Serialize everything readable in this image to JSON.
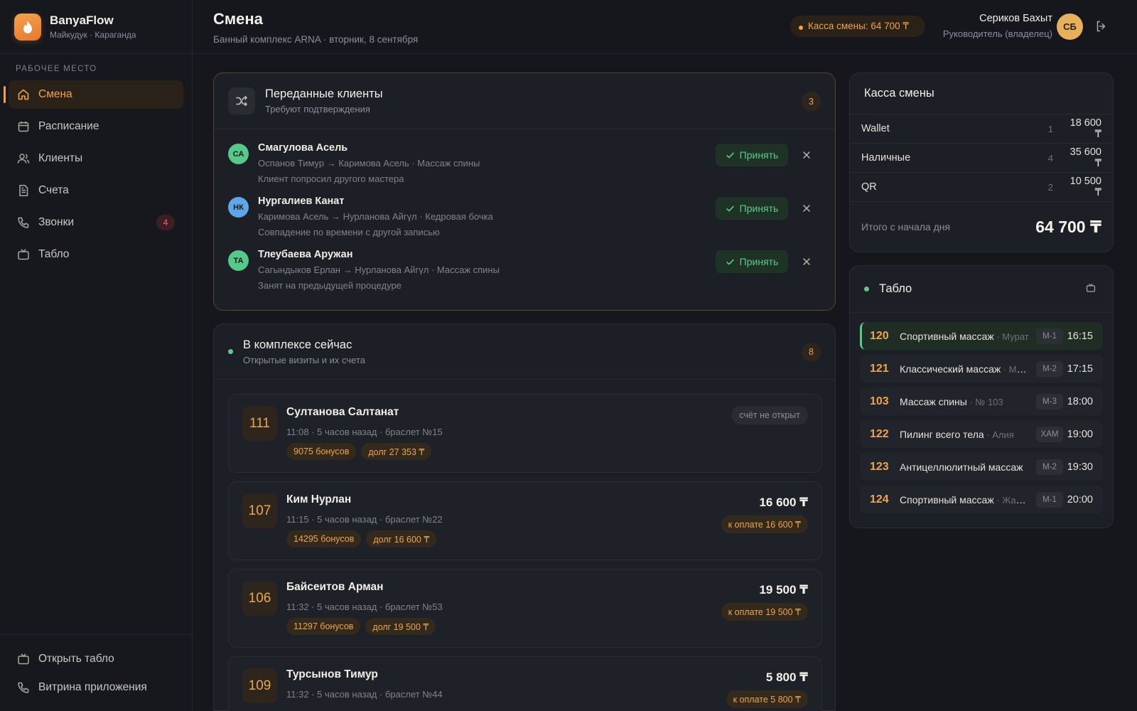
{
  "brand": {
    "name": "BanyaFlow",
    "location": "Майкудук · Караганда"
  },
  "sidebar": {
    "section_label": "РАБОЧЕЕ МЕСТО",
    "items": [
      {
        "label": "Смена",
        "icon": "home-icon",
        "active": true
      },
      {
        "label": "Расписание",
        "icon": "calendar-icon"
      },
      {
        "label": "Клиенты",
        "icon": "users-icon"
      },
      {
        "label": "Счета",
        "icon": "document-icon"
      },
      {
        "label": "Звонки",
        "icon": "phone-icon",
        "badge": "4"
      },
      {
        "label": "Табло",
        "icon": "tv-icon"
      }
    ],
    "bottom": [
      {
        "label": "Открыть табло",
        "icon": "tv-icon"
      },
      {
        "label": "Витрина приложения",
        "icon": "phone-icon"
      }
    ]
  },
  "header": {
    "title": "Смена",
    "subtitle": "Банный комплекс ARNA · вторник, 8 сентября",
    "cash_pill": "Касса смены: 64 700 ₸",
    "user_name": "Сериков Бахыт",
    "user_role": "Руководитель (владелец)",
    "user_initials": "СБ"
  },
  "transfers": {
    "title": "Переданные клиенты",
    "subtitle": "Требуют подтверждения",
    "count": "3",
    "accept_label": "Принять",
    "items": [
      {
        "initials": "СА",
        "avatar_color": "#57c88a",
        "name": "Смагулова Асель",
        "route": "Оспанов Тимур → Каримова Асель · Массаж спины",
        "reason": "Клиент попросил другого мастера"
      },
      {
        "initials": "НК",
        "avatar_color": "#5fa6e8",
        "name": "Нургалиев Канат",
        "route": "Каримова Асель → Нурланова Айгүл · Кедровая бочка",
        "reason": "Совпадение по времени с другой записью"
      },
      {
        "initials": "ТА",
        "avatar_color": "#57c88a",
        "name": "Тлеубаева Аружан",
        "route": "Сагындыков Ерлан → Нурланова Айгүл · Массаж спины",
        "reason": "Занят на предыдущей процедуре"
      }
    ]
  },
  "now": {
    "title": "В комплексе сейчас",
    "subtitle": "Открытые визиты и их счета",
    "count": "8",
    "visits": [
      {
        "room": "111",
        "name": "Султанова Салтанат",
        "meta": "11:08 · 5 часов назад · браслет №15",
        "bonus": "9075 бонусов",
        "debt": "долг 27 353 ₸",
        "status": "счёт не открыт"
      },
      {
        "room": "107",
        "name": "Ким Нурлан",
        "meta": "11:15 · 5 часов назад · браслет №22",
        "bonus": "14295 бонусов",
        "debt": "долг 16 600 ₸",
        "amount": "16 600 ₸",
        "pay": "к оплате 16 600 ₸"
      },
      {
        "room": "106",
        "name": "Байсеитов Арман",
        "meta": "11:32 · 5 часов назад · браслет №53",
        "bonus": "11297 бонусов",
        "debt": "долг 19 500 ₸",
        "amount": "19 500 ₸",
        "pay": "к оплате 19 500 ₸"
      },
      {
        "room": "109",
        "name": "Турсынов Тимур",
        "meta": "11:32 · 5 часов назад · браслет №44",
        "bonus": "",
        "debt": "",
        "amount": "5 800 ₸",
        "pay": "к оплате 5 800 ₸"
      }
    ]
  },
  "kassa": {
    "title": "Касса смены",
    "rows": [
      {
        "label": "Wallet",
        "count": "1",
        "sum": "18 600 ₸"
      },
      {
        "label": "Наличные",
        "count": "4",
        "sum": "35 600 ₸"
      },
      {
        "label": "QR",
        "count": "2",
        "sum": "10 500 ₸"
      }
    ],
    "total_label": "Итого с начала дня",
    "total_value": "64 700 ₸"
  },
  "tablo": {
    "title": "Табло",
    "rows": [
      {
        "num": "120",
        "service": "Спортивный массаж",
        "who": " · Мурат",
        "room": "М-1",
        "time": "16:15",
        "current": true
      },
      {
        "num": "121",
        "service": "Классический массаж",
        "who": " · Мурат",
        "room": "М-2",
        "time": "17:15"
      },
      {
        "num": "103",
        "service": "Массаж спины",
        "who": " · № 103",
        "room": "М-3",
        "time": "18:00"
      },
      {
        "num": "122",
        "service": "Пилинг всего тела",
        "who": " · Алия",
        "room": "ХАМ",
        "time": "19:00"
      },
      {
        "num": "123",
        "service": "Антицеллюлитный массаж",
        "who": "",
        "room": "М-2",
        "time": "19:30"
      },
      {
        "num": "124",
        "service": "Спортивный массаж",
        "who": " · Жанна",
        "room": "М-1",
        "time": "20:00"
      }
    ]
  },
  "colors": {
    "accent": "#f0a24b",
    "success": "#5ec98a",
    "danger": "#f06c6c",
    "background": "#15171d"
  }
}
